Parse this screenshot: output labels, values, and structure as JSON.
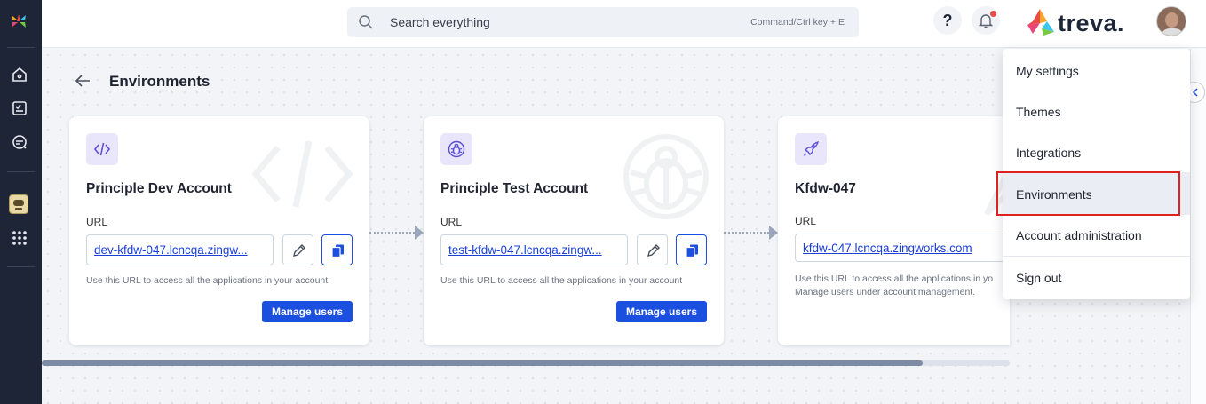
{
  "header": {
    "search_placeholder": "Search everything",
    "search_hint": "Command/Ctrl key + E",
    "help_symbol": "?",
    "brand_name": "treva."
  },
  "page": {
    "title": "Environments"
  },
  "environments": [
    {
      "name": "Principle Dev Account",
      "url_label": "URL",
      "url": "dev-kfdw-047.lcncqa.zingw...",
      "help_text": [
        "Use this URL to access all the applications in your account"
      ],
      "manage_label": "Manage users",
      "icon": "code-icon"
    },
    {
      "name": "Principle Test Account",
      "url_label": "URL",
      "url": "test-kfdw-047.lcncqa.zingw...",
      "help_text": [
        "Use this URL to access all the applications in your account"
      ],
      "manage_label": "Manage users",
      "icon": "bug-icon"
    },
    {
      "name": "Kfdw-047",
      "url_label": "URL",
      "url": "kfdw-047.lcncqa.zingworks.com",
      "help_text": [
        "Use this URL to access all the applications in yo",
        "Manage users under account management."
      ],
      "icon": "rocket-icon"
    }
  ],
  "menu": {
    "items": [
      "My settings",
      "Themes",
      "Integrations",
      "Environments",
      "Account administration",
      "Sign out"
    ],
    "active": "Environments",
    "highlight_color": "#e02020"
  },
  "colors": {
    "sidebar": "#1e2536",
    "accent": "#1a4fe0",
    "icon_tile": "#e9e5fb",
    "icon_stroke": "#5b4fd6"
  }
}
